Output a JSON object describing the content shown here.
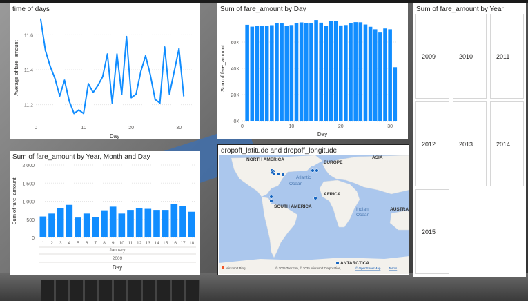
{
  "charts": {
    "time_of_days": {
      "title": "time of days",
      "chart_data": {
        "type": "line",
        "xlabel": "Day",
        "ylabel": "Average of fare_amount",
        "x": [
          1,
          2,
          3,
          4,
          5,
          6,
          7,
          8,
          9,
          10,
          11,
          12,
          13,
          14,
          15,
          16,
          17,
          18,
          19,
          20,
          21,
          22,
          23,
          24,
          25,
          26,
          27,
          28,
          29,
          30,
          31
        ],
        "values": [
          11.69,
          11.51,
          11.42,
          11.35,
          11.25,
          11.34,
          11.22,
          11.15,
          11.17,
          11.15,
          11.32,
          11.27,
          11.31,
          11.36,
          11.49,
          11.21,
          11.49,
          11.26,
          11.59,
          11.24,
          11.26,
          11.39,
          11.48,
          11.37,
          11.23,
          11.21,
          11.53,
          11.26,
          11.39,
          11.52,
          11.25
        ],
        "xlim": [
          0,
          33
        ],
        "ylim": [
          11.1,
          11.72
        ],
        "xticks": [
          0,
          10,
          20,
          30
        ],
        "yticks": [
          11.2,
          11.4,
          11.6
        ],
        "ytick_labels": [
          "11.2",
          "11.4",
          "11.6"
        ],
        "color": "#118DFF"
      }
    },
    "fare_by_day": {
      "title": "Sum of fare_amount by Day",
      "chart_data": {
        "type": "bar",
        "xlabel": "Day",
        "ylabel": "Sum of fare_amount",
        "x": [
          1,
          2,
          3,
          4,
          5,
          6,
          7,
          8,
          9,
          10,
          11,
          12,
          13,
          14,
          15,
          16,
          17,
          18,
          19,
          20,
          21,
          22,
          23,
          24,
          25,
          26,
          27,
          28,
          29,
          30,
          31
        ],
        "values": [
          73200,
          71800,
          72100,
          72200,
          72600,
          72900,
          74500,
          74200,
          72300,
          73000,
          74600,
          75000,
          74300,
          74700,
          76800,
          74800,
          72600,
          75800,
          75800,
          72700,
          73000,
          74700,
          75200,
          75100,
          73400,
          71700,
          69800,
          67300,
          70400,
          69800,
          40900
        ],
        "xlim": [
          0,
          32.5
        ],
        "ylim": [
          0,
          80000
        ],
        "xticks": [
          0,
          10,
          20,
          30
        ],
        "yticks": [
          0,
          20000,
          40000,
          60000
        ],
        "ytick_labels": [
          "0K",
          "20K",
          "40K",
          "60K"
        ],
        "color": "#118DFF"
      }
    },
    "fare_by_ymd": {
      "title": "Sum of fare_amount by Year, Month and Day",
      "chart_data": {
        "type": "bar",
        "xlabel": "Day",
        "ylabel": "Sum of fare_amount",
        "categories": [
          "1",
          "2",
          "3",
          "4",
          "5",
          "6",
          "7",
          "8",
          "9",
          "10",
          "11",
          "12",
          "13",
          "14",
          "15",
          "16",
          "17",
          "18"
        ],
        "values": [
          580,
          660,
          800,
          900,
          550,
          660,
          560,
          750,
          850,
          660,
          760,
          800,
          790,
          760,
          760,
          930,
          860,
          710
        ],
        "ylim": [
          0,
          2000
        ],
        "yticks": [
          0,
          500,
          1000,
          1500,
          2000
        ],
        "ytick_labels": [
          "0",
          "500",
          "1,000",
          "1,500",
          "2,000"
        ],
        "month_label": "January",
        "year_label": "2009",
        "color": "#118DFF"
      }
    }
  },
  "map": {
    "title": "dropoff_latitude and dropoff_longitude",
    "labels": {
      "north_america": "NORTH AMERICA",
      "europe": "EUROPE",
      "asia": "ASIA",
      "atlantic": "Atlantic",
      "ocean1": "Ocean",
      "africa": "AFRICA",
      "south_america": "SOUTH AMERICA",
      "indian": "Indian",
      "ocean2": "Ocean",
      "australia": "AUSTRA",
      "antarctica": "ANTARCTICA"
    },
    "attribution": "© 2025 TomTom, © 2025 Microsoft Corporation,",
    "osm_link": "© OpenStreetMap",
    "terms_link": "Terms",
    "brand": "Microsoft Bing",
    "land_color": "#f3f1ec",
    "water_color": "#abc7ed",
    "point_color": "#1565C0"
  },
  "slicer": {
    "title": "Sum of fare_amount by Year",
    "years": [
      "2009",
      "2010",
      "2011",
      "2012",
      "2013",
      "2014",
      "2015"
    ]
  }
}
